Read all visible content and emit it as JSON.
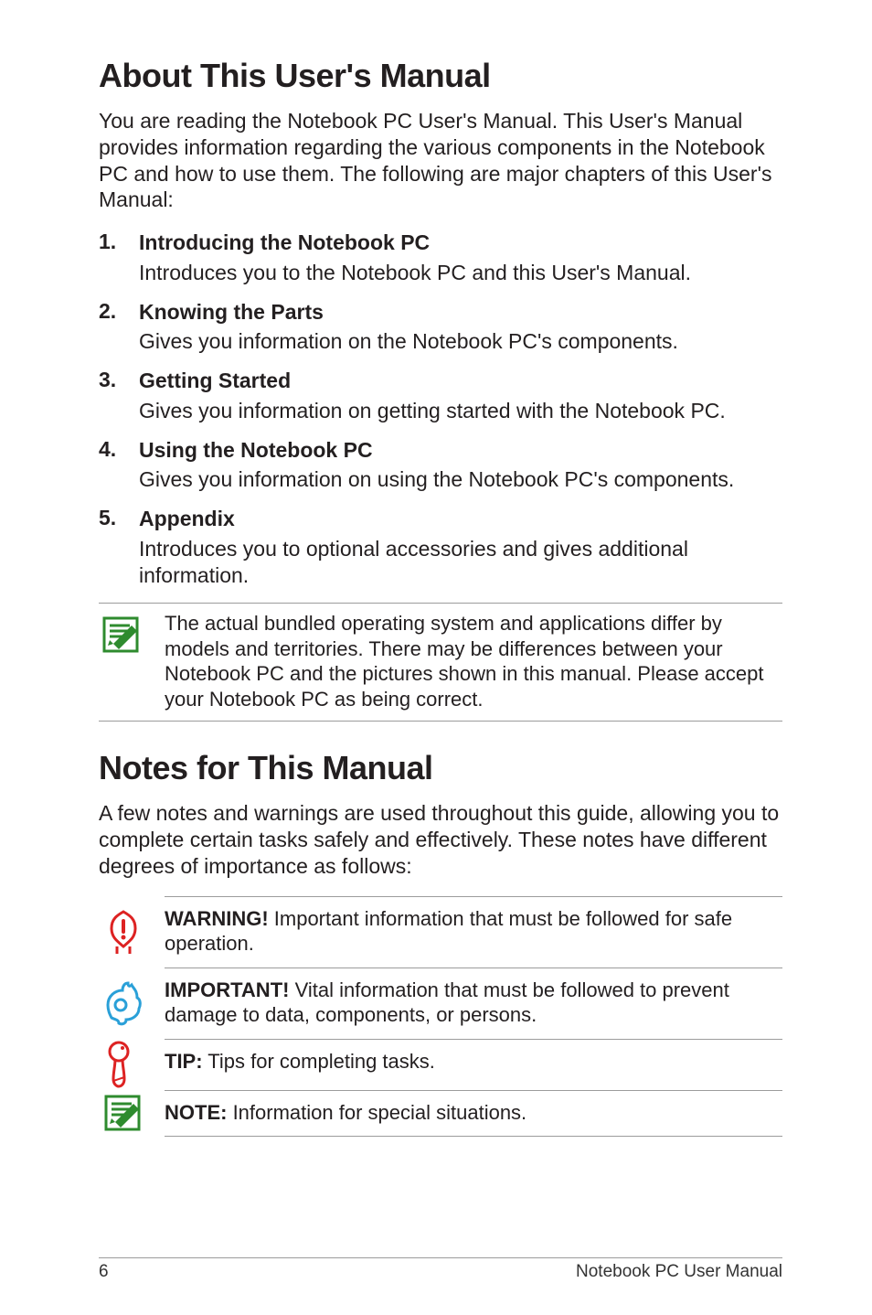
{
  "headings": {
    "about": "About This User's Manual",
    "notes": "Notes for This Manual"
  },
  "about_intro": "You are reading the Notebook PC User's Manual. This User's Manual provides information regarding the various components in the Notebook PC and how to use them. The following are major chapters of this User's Manual:",
  "chapters": [
    {
      "num": "1.",
      "title": "Introducing the Notebook PC",
      "desc": "Introduces you to the Notebook PC and this User's Manual."
    },
    {
      "num": "2.",
      "title": "Knowing the Parts",
      "desc": "Gives you information on the Notebook PC's components."
    },
    {
      "num": "3.",
      "title": "Getting Started",
      "desc": "Gives you information on getting started with the Notebook PC."
    },
    {
      "num": "4.",
      "title": "Using the Notebook PC",
      "desc": "Gives you information on using the Notebook PC's components."
    },
    {
      "num": "5.",
      "title": "Appendix",
      "desc": "Introduces you to optional accessories and gives additional information."
    }
  ],
  "bundled_note": "The actual bundled operating system and applications differ by models and territories. There may be differences between your Notebook PC and the pictures shown in this manual. Please accept your Notebook PC as being correct.",
  "notes_intro": "A few notes and warnings are used throughout this guide, allowing you to complete certain tasks safely and effectively. These notes have different degrees of importance as follows:",
  "callouts": {
    "warning": {
      "label": "WARNING!",
      "text": " Important information that must be followed for safe operation."
    },
    "important": {
      "label": "IMPORTANT!",
      "text": " Vital information that must be followed to prevent damage to data, components, or persons."
    },
    "tip": {
      "label": "TIP:",
      "text": " Tips for completing tasks."
    },
    "note": {
      "label": "NOTE:",
      "text": "  Information for special situations."
    }
  },
  "footer": {
    "page": "6",
    "title": "Notebook PC User Manual"
  }
}
